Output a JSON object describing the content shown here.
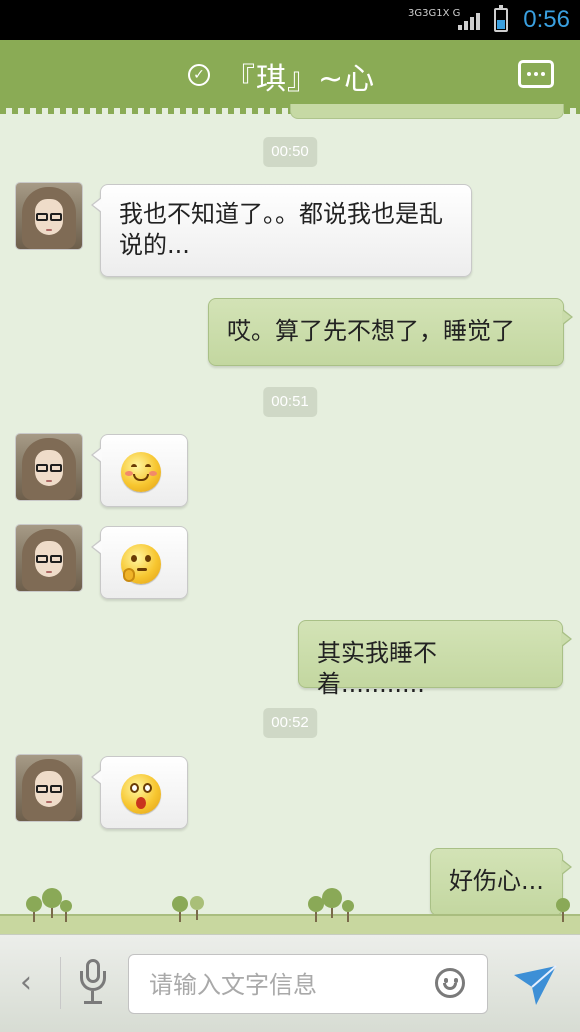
{
  "status_bar": {
    "network_labels": [
      "3G",
      "3G",
      "1X",
      "G"
    ],
    "time": "0:56",
    "icons": [
      "network-type-icon",
      "signal-bars-icon",
      "battery-icon"
    ]
  },
  "header": {
    "verified_icon": "check-circle-icon",
    "title": "『琪』~心",
    "more_icon": "more-icon"
  },
  "messages": [
    {
      "kind": "timestamp",
      "text": "00:50"
    },
    {
      "kind": "incoming",
      "text": "我也不知道了。。都说我也是乱说的..."
    },
    {
      "kind": "outgoing",
      "text": "哎。算了先不想了，睡觉了"
    },
    {
      "kind": "timestamp",
      "text": "00:51"
    },
    {
      "kind": "incoming-emoji",
      "emoji": "blush-emoji-icon"
    },
    {
      "kind": "incoming-emoji",
      "emoji": "thinking-emoji-icon"
    },
    {
      "kind": "outgoing",
      "text": "其实我睡不着..........."
    },
    {
      "kind": "timestamp",
      "text": "00:52"
    },
    {
      "kind": "incoming-emoji",
      "emoji": "surprised-emoji-icon"
    },
    {
      "kind": "outgoing",
      "text": "好伤心..."
    }
  ],
  "input_bar": {
    "back_label": "‹",
    "voice_icon": "microphone-icon",
    "placeholder": "请输入文字信息",
    "emoji_icon": "smiley-icon",
    "send_icon": "send-icon"
  },
  "colors": {
    "header_bg": "#8aab55",
    "chat_bg": "#e6efde",
    "outgoing_bubble": "#c6d9a4",
    "incoming_bubble": "#f7f7f7",
    "time_accent": "#3aa0e0"
  }
}
